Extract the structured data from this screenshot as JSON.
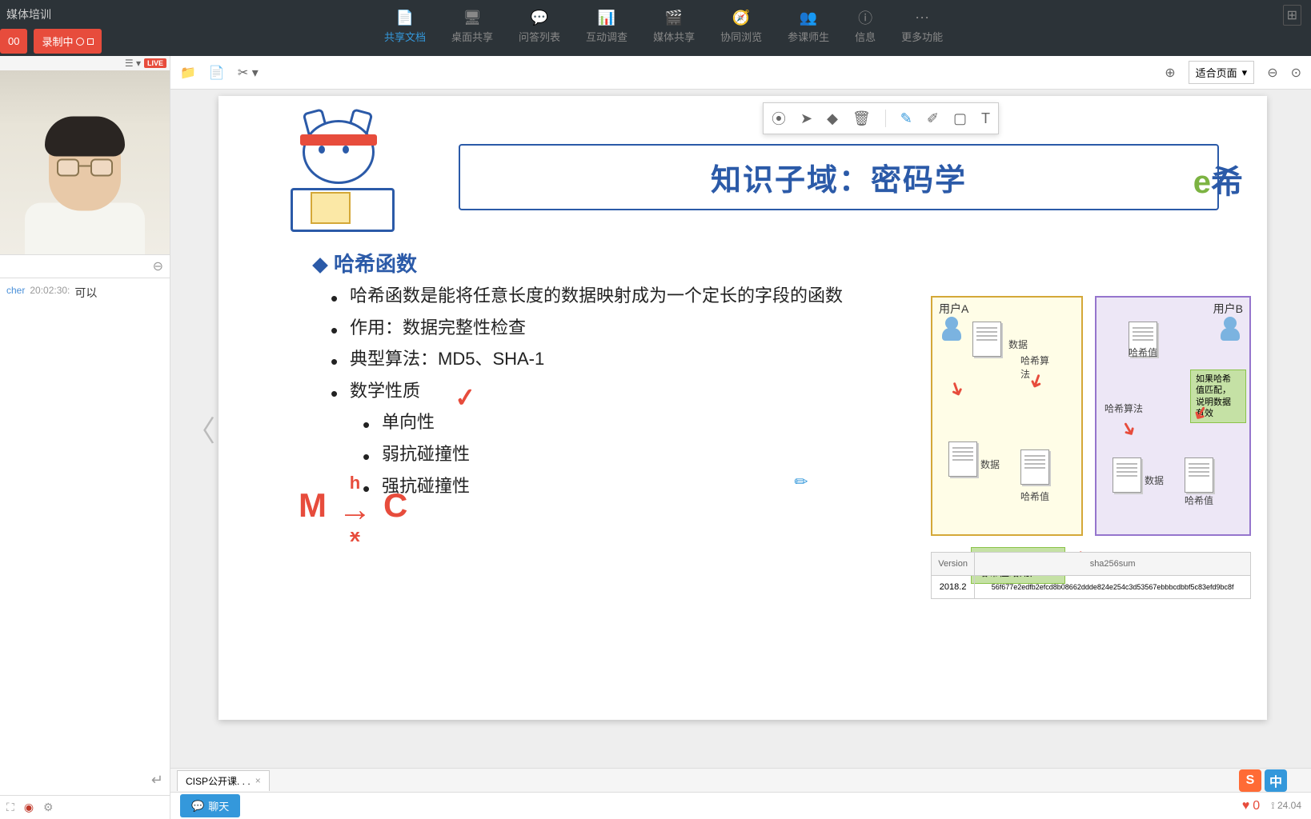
{
  "window": {
    "title": "媒体培训"
  },
  "recording": {
    "time": "00",
    "status": "录制中"
  },
  "nav": [
    {
      "icon": "📄",
      "label": "共享文档",
      "active": true
    },
    {
      "icon": "🖥",
      "label": "桌面共享"
    },
    {
      "icon": "💬",
      "label": "问答列表"
    },
    {
      "icon": "📊",
      "label": "互动调查"
    },
    {
      "icon": "🎬",
      "label": "媒体共享"
    },
    {
      "icon": "🧭",
      "label": "协同浏览"
    },
    {
      "icon": "👥",
      "label": "参课师生"
    },
    {
      "icon": "ⓘ",
      "label": "信息"
    },
    {
      "icon": "⋯",
      "label": "更多功能"
    }
  ],
  "video": {
    "live_badge": "LIVE"
  },
  "chat": {
    "messages": [
      {
        "user": "cher",
        "time": "20:02:30:",
        "text": "可以"
      }
    ]
  },
  "doc_toolbar": {
    "zoom_label": "适合页面"
  },
  "slide": {
    "title": "知识子域：密码学",
    "logo": {
      "e": "e",
      "text": "希"
    },
    "section": "哈希函数",
    "bullets": {
      "b1": "哈希函数是能将任意长度的数据映射成为一个定长的字段的函数",
      "b2": "作用：数据完整性检查",
      "b3": "典型算法：MD5、SHA-1",
      "b4": "数学性质",
      "s1": "单向性",
      "s2": "弱抗碰撞性",
      "s3": "强抗碰撞性"
    },
    "formula": {
      "m": "M",
      "h": "h",
      "x": "x",
      "arrow": "→",
      "c": "C"
    },
    "checkmark": "✓",
    "diagram": {
      "user_a": "用户A",
      "user_b": "用户B",
      "data": "数据",
      "hash_algo": "哈希算\n法",
      "hash_algo2": "哈希算法",
      "hash_val": "哈希值",
      "note": "如果哈希\n值匹配，\n说明数据\n有效",
      "send": "用户A发送数据和\n哈希值给用户 B"
    },
    "table": {
      "h1": "Version",
      "h2": "sha256sum",
      "v": "2018.2",
      "hash": "56f677e2edfb2efcd8b08662ddde824e254c3d53567ebbbcdbbf5c83efd9bc8f"
    }
  },
  "doc_tab": {
    "name": "CISP公开课. . ."
  },
  "footer": {
    "chat_btn": "聊天",
    "likes": "0",
    "stats": "24.04"
  },
  "ime": {
    "s": "S",
    "c": "中"
  }
}
